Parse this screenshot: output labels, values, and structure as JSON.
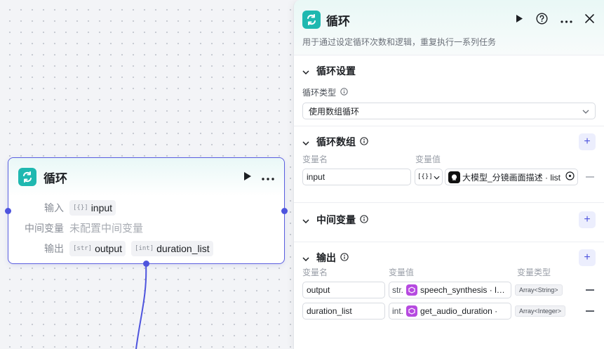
{
  "node": {
    "title": "循环",
    "rows": [
      {
        "label": "输入",
        "tags": [
          {
            "type": "[{}]",
            "name": "input"
          }
        ]
      },
      {
        "label": "中间变量",
        "empty": "未配置中间变量"
      },
      {
        "label": "输出",
        "tags": [
          {
            "type": "[str]",
            "name": "output"
          },
          {
            "type": "[int]",
            "name": "duration_list"
          }
        ]
      }
    ]
  },
  "panel": {
    "title": "循环",
    "description": "用于通过设定循环次数和逻辑，重复执行一系列任务",
    "loop_settings": {
      "title": "循环设置",
      "type_label": "循环类型",
      "type_value": "使用数组循环"
    },
    "loop_array": {
      "title": "循环数组",
      "col_name": "变量名",
      "col_value": "变量值",
      "rows": [
        {
          "name": "input",
          "type_prefix": "[{}]",
          "ref": "大模型_分镜画面描述 · list"
        }
      ]
    },
    "intermediate": {
      "title": "中间变量"
    },
    "output": {
      "title": "输出",
      "col_name": "变量名",
      "col_value": "变量值",
      "col_type": "变量类型",
      "rows": [
        {
          "name": "output",
          "prefix": "str.",
          "ref": "speech_synthesis · l…",
          "type": "Array<String>"
        },
        {
          "name": "duration_list",
          "prefix": "int.",
          "ref": "get_audio_duration ·",
          "type": "Array<Integer>"
        }
      ]
    }
  },
  "colors": {
    "accent": "#4e54de",
    "teal": "#1fb8b0",
    "plugin": "#b64ae0"
  }
}
